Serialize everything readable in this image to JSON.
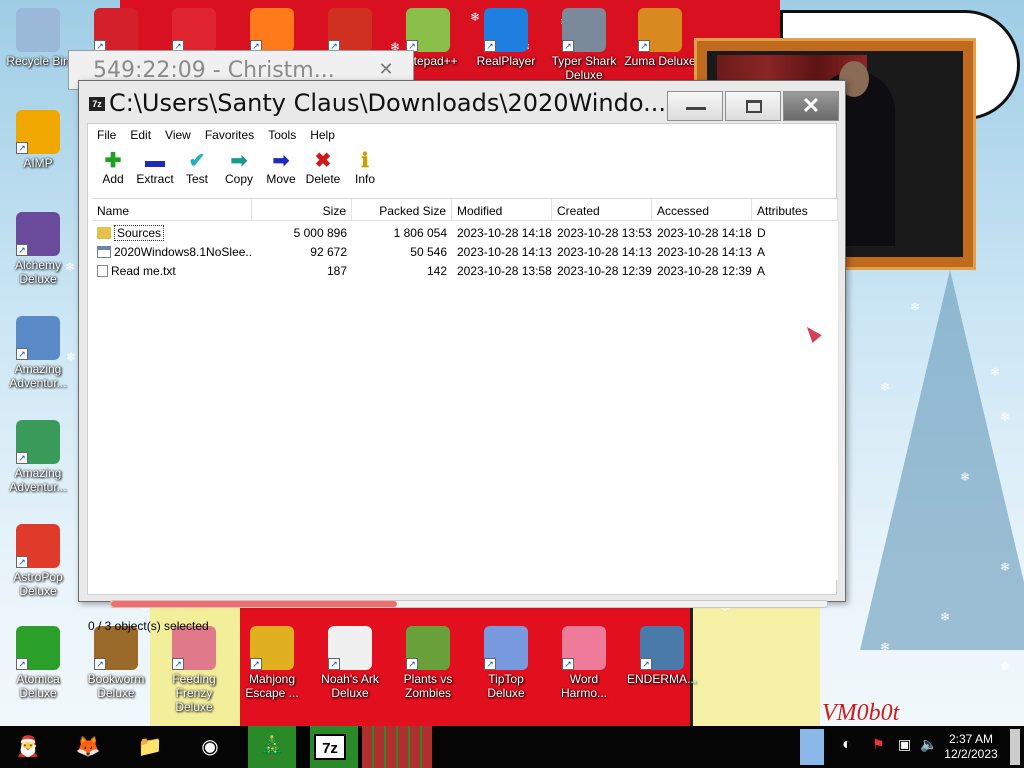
{
  "desktop": {
    "icons": [
      {
        "label": "Recycle Bin",
        "icon": "recycle-bin-icon",
        "color": "#9ab8d8"
      },
      {
        "label": "",
        "icon": "number-2-game-icon",
        "color": "#d4202a"
      },
      {
        "label": "",
        "icon": "zuma-red-ball-icon",
        "color": "#e0242f"
      },
      {
        "label": "",
        "icon": "firefox-icon",
        "color": "#ff7a1a"
      },
      {
        "label": "",
        "icon": "japanese-gate-icon",
        "color": "#d03020"
      },
      {
        "label": "Notepad++",
        "icon": "notepad-plus-plus-icon",
        "color": "#8ac04a"
      },
      {
        "label": "RealPlayer",
        "icon": "realplayer-icon",
        "color": "#1e7fe0"
      },
      {
        "label": "Typer Shark Deluxe",
        "icon": "typer-shark-icon",
        "color": "#7a8a9a"
      },
      {
        "label": "Zuma Deluxe",
        "icon": "zuma-deluxe-icon",
        "color": "#d88a20"
      },
      {
        "label": "AIMP",
        "icon": "aimp-icon",
        "color": "#f0a800"
      },
      {
        "label": "Alchemy Deluxe",
        "icon": "alchemy-wizard-icon",
        "color": "#6a4a9a"
      },
      {
        "label": "Amazing Adventur...",
        "icon": "amazing-adventures-icon",
        "color": "#5a8ac8"
      },
      {
        "label": "Amazing Adventur...",
        "icon": "amazing-adventures-globe-icon",
        "color": "#3a9a5a"
      },
      {
        "label": "AstroPop Deluxe",
        "icon": "astropop-icon",
        "color": "#e03a2a"
      },
      {
        "label": "Atomica Deluxe",
        "icon": "atomica-icon",
        "color": "#2aa02a"
      },
      {
        "label": "Bookworm Deluxe",
        "icon": "bookworm-icon",
        "color": "#9a6a2a"
      },
      {
        "label": "Feeding Frenzy Deluxe",
        "icon": "feeding-frenzy-icon",
        "color": "#e07a8a"
      },
      {
        "label": "Mahjong Escape ...",
        "icon": "mahjong-icon",
        "color": "#e0b020"
      },
      {
        "label": "Noah's Ark Deluxe",
        "icon": "noahs-ark-dove-icon",
        "color": "#f0f0f0"
      },
      {
        "label": "Plants vs Zombies",
        "icon": "plants-vs-zombies-icon",
        "color": "#6aa03a"
      },
      {
        "label": "TipTop Deluxe",
        "icon": "tiptop-icon",
        "color": "#7a9ae0"
      },
      {
        "label": "Word Harmo...",
        "icon": "word-harmony-flower-icon",
        "color": "#f07a9a"
      },
      {
        "label": "ENDERMA...",
        "icon": "enderman-program-icon",
        "color": "#4a7aaa"
      }
    ]
  },
  "bg_window": {
    "title": "549:22:09 - Christm..."
  },
  "window": {
    "title": "C:\\Users\\Santy Claus\\Downloads\\2020Windo...",
    "menu": [
      "File",
      "Edit",
      "View",
      "Favorites",
      "Tools",
      "Help"
    ],
    "toolbar": [
      {
        "label": "Add",
        "icon": "add-plus-icon",
        "glyph": "✚",
        "color": "#1fa01f"
      },
      {
        "label": "Extract",
        "icon": "extract-minus-icon",
        "glyph": "▬",
        "color": "#1d2bb8"
      },
      {
        "label": "Test",
        "icon": "test-check-icon",
        "glyph": "✔",
        "color": "#22b0c0"
      },
      {
        "label": "Copy",
        "icon": "copy-arrow-icon",
        "glyph": "➡",
        "color": "#1a9a8a"
      },
      {
        "label": "Move",
        "icon": "move-arrow-icon",
        "glyph": "➡",
        "color": "#1d2bb8"
      },
      {
        "label": "Delete",
        "icon": "delete-x-icon",
        "glyph": "✖",
        "color": "#d01818"
      },
      {
        "label": "Info",
        "icon": "info-icon",
        "glyph": "ℹ",
        "color": "#c8a000"
      }
    ],
    "columns": [
      "Name",
      "Size",
      "Packed Size",
      "Modified",
      "Created",
      "Accessed",
      "Attributes"
    ],
    "rows": [
      {
        "type": "folder",
        "name": "Sources",
        "size": "5 000 896",
        "packed": "1 806 054",
        "modified": "2023-10-28 14:18",
        "created": "2023-10-28 13:53",
        "accessed": "2023-10-28 14:18",
        "attr": "D"
      },
      {
        "type": "exe",
        "name": "2020Windows8.1NoSlee...",
        "size": "92 672",
        "packed": "50 546",
        "modified": "2023-10-28 14:13",
        "created": "2023-10-28 14:13",
        "accessed": "2023-10-28 14:13",
        "attr": "A"
      },
      {
        "type": "txt",
        "name": "Read me.txt",
        "size": "187",
        "packed": "142",
        "modified": "2023-10-28 13:58",
        "created": "2023-10-28 12:39",
        "accessed": "2023-10-28 12:39",
        "attr": "A"
      }
    ],
    "scroll_fraction": 0.4,
    "status": "0 / 3 object(s) selected"
  },
  "wallpaper_text": "VM0b0t",
  "taskbar": {
    "clock_time": "2:37 AM",
    "clock_date": "12/2/2023",
    "apps": [
      {
        "icon": "santa-start-icon",
        "glyph": "🎅",
        "active": false
      },
      {
        "icon": "firefox-taskbar-icon",
        "glyph": "🦊",
        "active": false
      },
      {
        "icon": "file-explorer-icon",
        "glyph": "📁",
        "active": false
      },
      {
        "icon": "chrome-icon",
        "glyph": "◉",
        "active": false
      },
      {
        "icon": "christmas-tree-icon",
        "glyph": "🎄",
        "active": true
      },
      {
        "icon": "7zip-taskbar-icon",
        "glyph": "7z",
        "active": true
      },
      {
        "icon": "window-thumb-icon",
        "glyph": "",
        "active": true
      }
    ]
  }
}
